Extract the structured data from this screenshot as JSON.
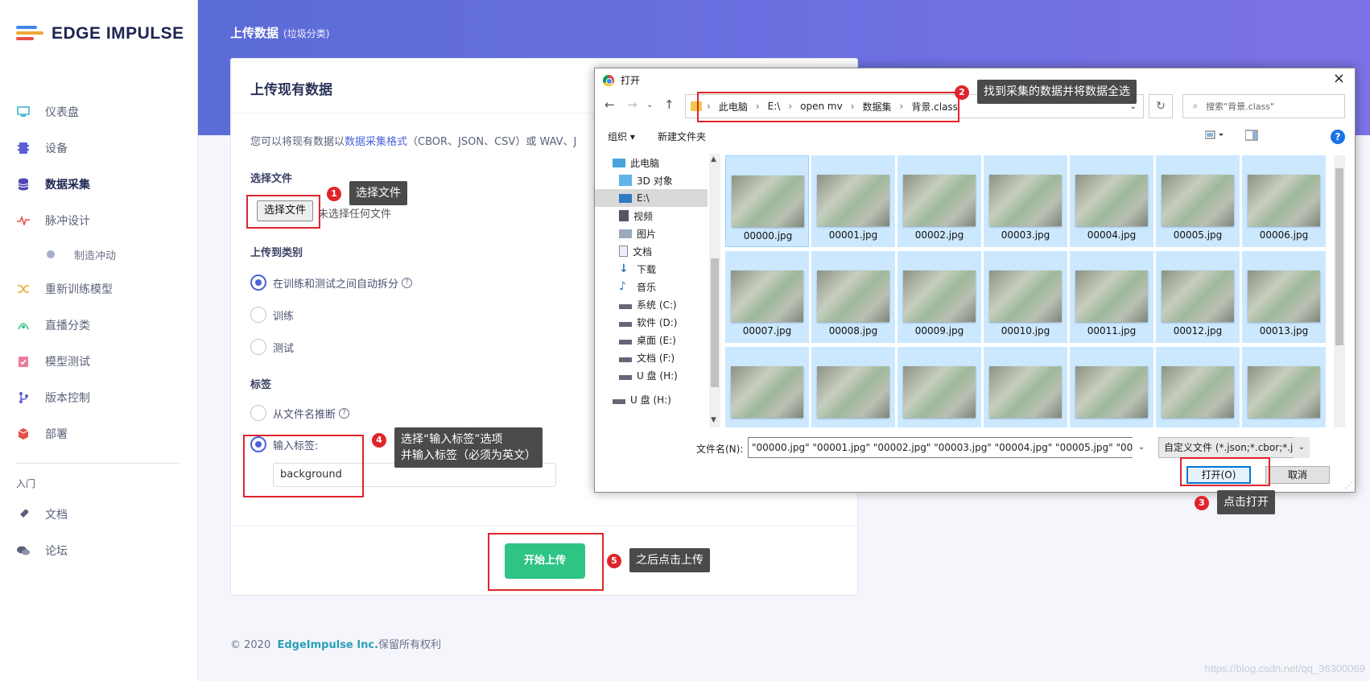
{
  "app": {
    "name": "EDGE IMPULSE"
  },
  "sidebar": {
    "items": [
      {
        "label": "仪表盘",
        "icon": "monitor-icon"
      },
      {
        "label": "设备",
        "icon": "chip-icon"
      },
      {
        "label": "数据采集",
        "icon": "database-icon",
        "active": true
      },
      {
        "label": "脉冲设计",
        "icon": "pulse-icon"
      },
      {
        "label": "制造冲动",
        "icon": "dot-icon",
        "sub": true
      },
      {
        "label": "重新训练模型",
        "icon": "shuffle-icon"
      },
      {
        "label": "直播分类",
        "icon": "live-icon"
      },
      {
        "label": "模型测试",
        "icon": "clipboard-check-icon"
      },
      {
        "label": "版本控制",
        "icon": "branch-icon"
      },
      {
        "label": "部署",
        "icon": "box-icon"
      }
    ],
    "section_title": "入门",
    "bottom_items": [
      {
        "label": "文档",
        "icon": "rocket-icon"
      },
      {
        "label": "论坛",
        "icon": "chat-icon"
      }
    ]
  },
  "header": {
    "title": "上传数据",
    "subtitle": "(垃圾分类)"
  },
  "card": {
    "title": "上传现有数据",
    "desc_prefix": "您可以将现有数据以",
    "desc_link": "数据采集格式",
    "desc_suffix": "（CBOR、JSON、CSV）或 WAV、J",
    "select_file_label": "选择文件",
    "file_button": "选择文件",
    "no_file": "未选择任何文件",
    "category_label": "上传到类别",
    "category_options": [
      {
        "label": "在训练和测试之间自动拆分",
        "checked": true,
        "help": "?"
      },
      {
        "label": "训练",
        "checked": false
      },
      {
        "label": "测试",
        "checked": false
      }
    ],
    "tag_label": "标签",
    "tag_options": [
      {
        "label": "从文件名推断",
        "checked": false,
        "help": "?"
      },
      {
        "label": "输入标签:",
        "checked": true
      }
    ],
    "tag_value": "background",
    "upload_button": "开始上传"
  },
  "footer": {
    "copyright": "© 2020",
    "brand": "EdgeImpulse Inc.",
    "rights": "保留所有权利"
  },
  "dialog": {
    "title": "打开",
    "close": "×",
    "breadcrumb": [
      "此电脑",
      "E:\\",
      "open mv",
      "数据集",
      "背景.class"
    ],
    "search_placeholder": "搜索\"背景.class\"",
    "organize": "组织 ▾",
    "new_folder": "新建文件夹",
    "help": "?",
    "tree": [
      {
        "label": "此电脑",
        "icon": "computer-icon"
      },
      {
        "label": "3D 对象",
        "icon": "cube-icon"
      },
      {
        "label": "E:\\",
        "icon": "drive-icon",
        "selected": true
      },
      {
        "label": "视频",
        "icon": "video-icon"
      },
      {
        "label": "图片",
        "icon": "picture-icon"
      },
      {
        "label": "文档",
        "icon": "document-icon"
      },
      {
        "label": "下载",
        "icon": "download-icon"
      },
      {
        "label": "音乐",
        "icon": "music-icon"
      },
      {
        "label": "系统 (C:)",
        "icon": "drive-icon"
      },
      {
        "label": "软件 (D:)",
        "icon": "drive-icon"
      },
      {
        "label": "桌面 (E:)",
        "icon": "drive-icon"
      },
      {
        "label": "文档 (F:)",
        "icon": "drive-icon"
      },
      {
        "label": "U 盘 (H:)",
        "icon": "usb-icon"
      },
      {
        "label": "U 盘 (H:)",
        "icon": "usb-icon"
      }
    ],
    "files": [
      "00000.jpg",
      "00001.jpg",
      "00002.jpg",
      "00003.jpg",
      "00004.jpg",
      "00005.jpg",
      "00006.jpg",
      "00007.jpg",
      "00008.jpg",
      "00009.jpg",
      "00010.jpg",
      "00011.jpg",
      "00012.jpg",
      "00013.jpg",
      "",
      "",
      "",
      "",
      "",
      "",
      ""
    ],
    "filename_label": "文件名(N):",
    "filename_value": "\"00000.jpg\" \"00001.jpg\" \"00002.jpg\" \"00003.jpg\" \"00004.jpg\" \"00005.jpg\" \"00006.jpg\" \"00",
    "filetype": "自定义文件 (*.json;*.cbor;*.jpg",
    "open_button": "打开(O)",
    "cancel_button": "取消"
  },
  "annotations": [
    {
      "num": "1",
      "text": "选择文件"
    },
    {
      "num": "2",
      "text": "找到采集的数据并将数据全选"
    },
    {
      "num": "3",
      "text": "点击打开"
    },
    {
      "num": "4",
      "text": "选择“输入标签”选项",
      "text2": "并输入标签（必须为英文）"
    },
    {
      "num": "5",
      "text": "之后点击上传"
    }
  ],
  "watermark": "https://blog.csdn.net/qq_36300069",
  "colors": {
    "accent": "#4a64d8",
    "upload_green": "#2ec484",
    "annotation_red": "#e0242b",
    "hero_start": "#5b6cd6",
    "hero_end": "#7d72e6"
  }
}
